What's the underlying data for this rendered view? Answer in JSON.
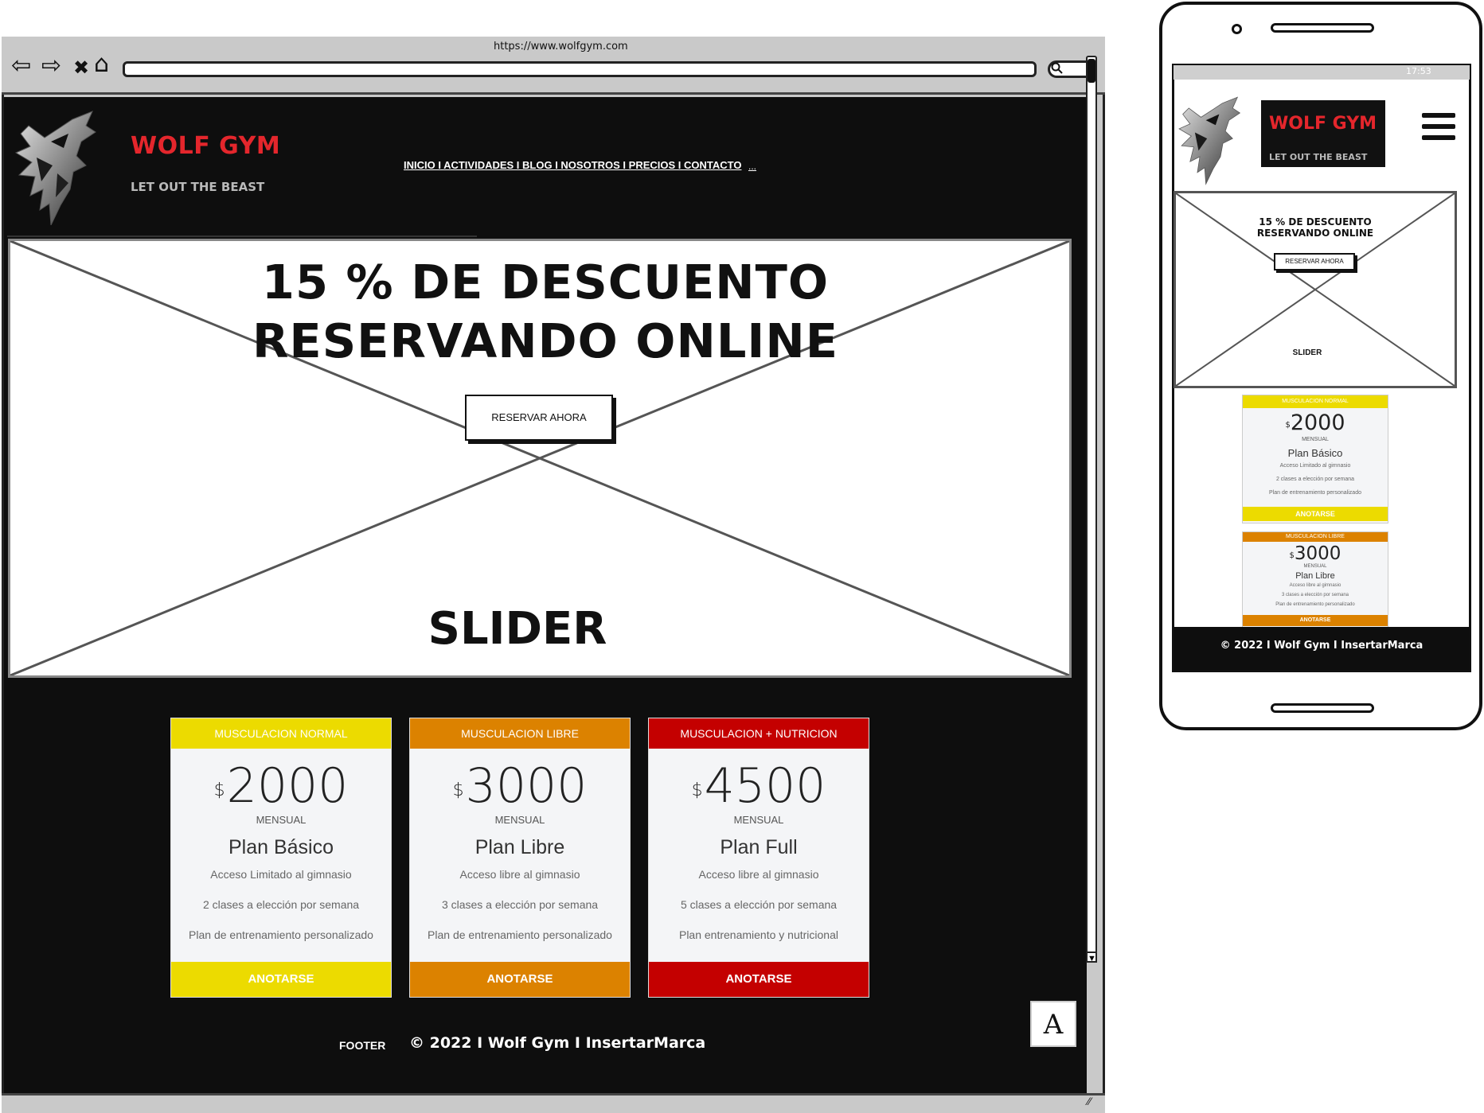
{
  "browser": {
    "url": "https://www.wolfgym.com",
    "nav_back": "⇦",
    "nav_forward": "⇨",
    "nav_close": "✖",
    "nav_home": "⌂",
    "search_icon": "magnifier-icon"
  },
  "site": {
    "title": "WOLF GYM",
    "tagline": "LET OUT THE BEAST",
    "nav": "INICIO I ACTIVIDADES I BLOG I NOSOTROS I PRECIOS I CONTACTO",
    "nav_more": "...",
    "hero": {
      "line1": "15 % DE DESCUENTO",
      "line2": "RESERVANDO ONLINE",
      "button": "RESERVAR AHORA",
      "slider_label": "SLIDER"
    },
    "plans": [
      {
        "header": "MUSCULACION NORMAL",
        "currency": "$",
        "price": "2000",
        "period": "MENSUAL",
        "name": "Plan Básico",
        "features": [
          "Acceso Limitado al gimnasio",
          "2 clases a elección por semana",
          "Plan de entrenamiento personalizado"
        ],
        "button": "ANOTARSE",
        "color": "#ecdb00"
      },
      {
        "header": "MUSCULACION LIBRE",
        "currency": "$",
        "price": "3000",
        "period": "MENSUAL",
        "name": "Plan Libre",
        "features": [
          "Acceso libre al gimnasio",
          "3 clases a elección por semana",
          "Plan de entrenamiento personalizado"
        ],
        "button": "ANOTARSE",
        "color": "#dc8200"
      },
      {
        "header": "MUSCULACION + NUTRICION",
        "currency": "$",
        "price": "4500",
        "period": "MENSUAL",
        "name": "Plan Full",
        "features": [
          "Acceso libre al gimnasio",
          "5 clases a elección por semana",
          "Plan entrenamiento y nutricional"
        ],
        "button": "ANOTARSE",
        "color": "#c40000"
      }
    ],
    "footer_label": "FOOTER",
    "footer_text": "© 2022 I Wolf Gym I InsertarMarca",
    "brand_badge": "A"
  },
  "mobile": {
    "status": "17:53",
    "title": "WOLF GYM",
    "tagline": "LET OUT THE BEAST",
    "hero_line1": "15 % DE DESCUENTO",
    "hero_line2": "RESERVANDO ONLINE",
    "button": "RESERVAR AHORA",
    "slider_label": "SLIDER",
    "plans": [
      {
        "header": "MUSCULACION NORMAL",
        "currency": "$",
        "price": "2000",
        "period": "MENSUAL",
        "name": "Plan Básico",
        "features": [
          "Acceso Limitado al gimnasio",
          "2 clases a elección por semana",
          "Plan de entrenamiento personalizado"
        ],
        "button": "ANOTARSE"
      },
      {
        "header": "MUSCULACION LIBRE",
        "currency": "$",
        "price": "3000",
        "period": "MENSUAL",
        "name": "Plan Libre",
        "features": [
          "Acceso libre al gimnasio",
          "3 clases a elección por semana",
          "Plan de entrenamiento personalizado"
        ],
        "button": "ANOTARSE"
      }
    ],
    "footer_text": "© 2022 I Wolf Gym I InsertarMarca"
  }
}
